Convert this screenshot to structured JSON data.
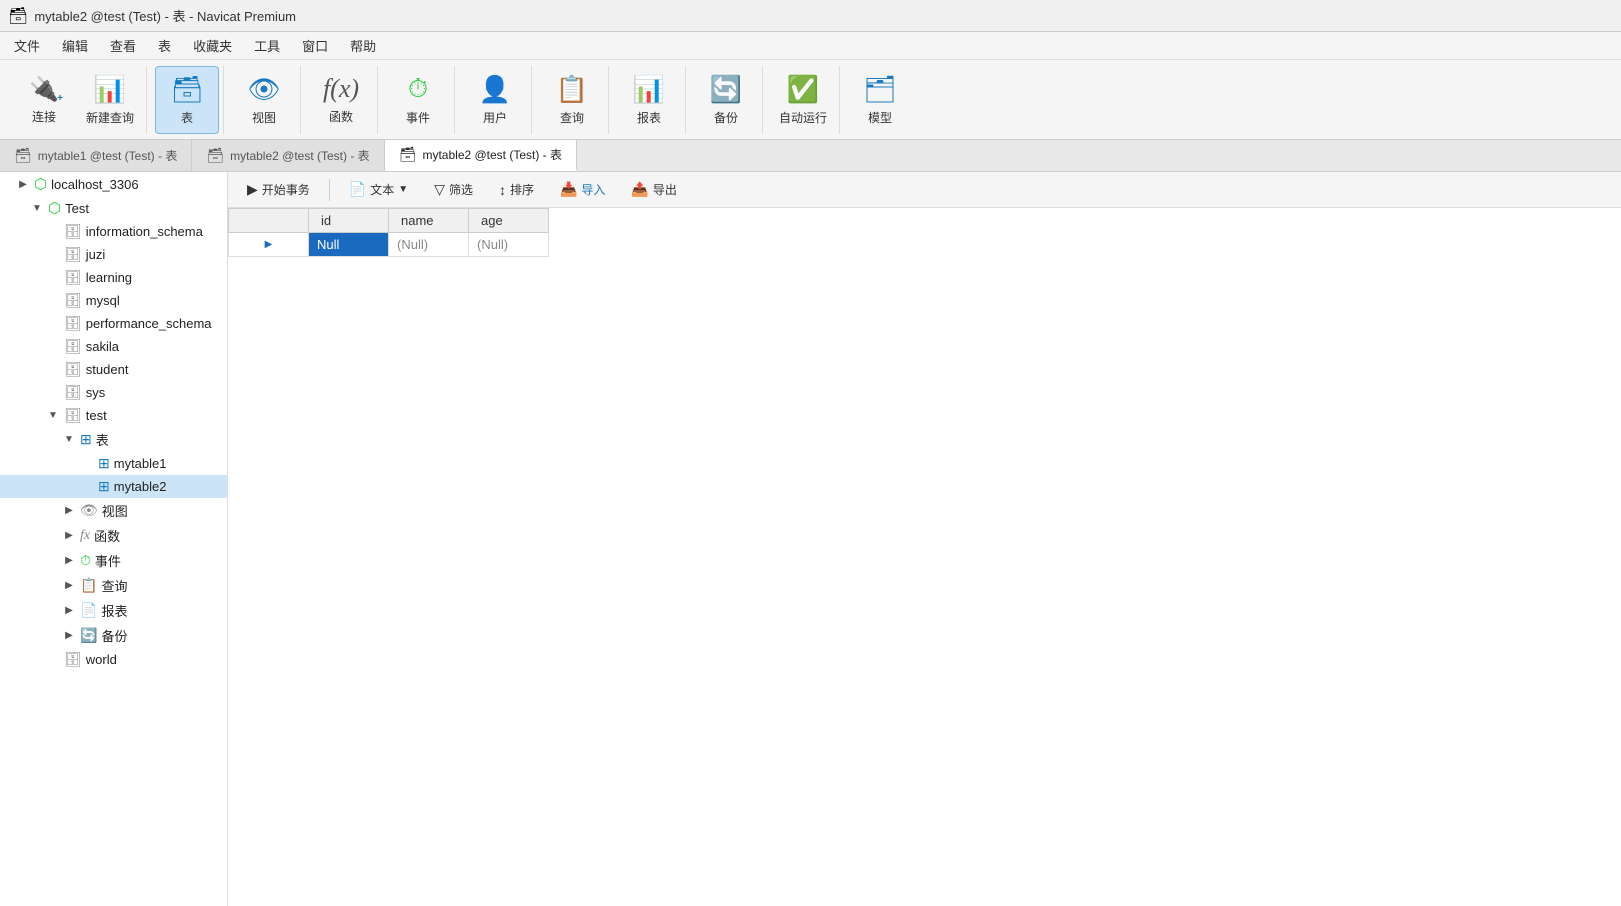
{
  "window": {
    "title": "mytable2 @test (Test) - 表 - Navicat Premium"
  },
  "menu": {
    "items": [
      "文件",
      "编辑",
      "查看",
      "表",
      "收藏夹",
      "工具",
      "窗口",
      "帮助"
    ]
  },
  "toolbar": {
    "groups": [
      {
        "buttons": [
          {
            "id": "connect",
            "label": "连接",
            "icon": "🔌"
          },
          {
            "id": "new-query",
            "label": "新建查询",
            "icon": "📊"
          }
        ]
      },
      {
        "buttons": [
          {
            "id": "table",
            "label": "表",
            "icon": "🗃",
            "active": true
          }
        ]
      },
      {
        "buttons": [
          {
            "id": "view",
            "label": "视图",
            "icon": "👁"
          }
        ]
      },
      {
        "buttons": [
          {
            "id": "function",
            "label": "函数",
            "icon": "𝑓"
          }
        ]
      },
      {
        "buttons": [
          {
            "id": "event",
            "label": "事件",
            "icon": "⏰"
          }
        ]
      },
      {
        "buttons": [
          {
            "id": "user",
            "label": "用户",
            "icon": "👤"
          }
        ]
      },
      {
        "buttons": [
          {
            "id": "query",
            "label": "查询",
            "icon": "📋"
          }
        ]
      },
      {
        "buttons": [
          {
            "id": "report",
            "label": "报表",
            "icon": "📊"
          }
        ]
      },
      {
        "buttons": [
          {
            "id": "backup",
            "label": "备份",
            "icon": "💾"
          }
        ]
      },
      {
        "buttons": [
          {
            "id": "autorun",
            "label": "自动运行",
            "icon": "⚙"
          }
        ]
      },
      {
        "buttons": [
          {
            "id": "model",
            "label": "模型",
            "icon": "🗂"
          }
        ]
      }
    ]
  },
  "tabs": [
    {
      "id": "tab1",
      "label": "mytable1 @test (Test) - 表",
      "active": false
    },
    {
      "id": "tab2",
      "label": "mytable2 @test (Test) - 表",
      "active": false
    },
    {
      "id": "tab3",
      "label": "mytable2 @test (Test) - 表",
      "active": true
    }
  ],
  "sidebar": {
    "items": [
      {
        "id": "localhost",
        "label": "localhost_3306",
        "level": 0,
        "expanded": true,
        "type": "connection",
        "arrow": "▶"
      },
      {
        "id": "test-db",
        "label": "Test",
        "level": 1,
        "expanded": true,
        "type": "folder",
        "arrow": "▼"
      },
      {
        "id": "information_schema",
        "label": "information_schema",
        "level": 2,
        "type": "database",
        "arrow": ""
      },
      {
        "id": "juzi",
        "label": "juzi",
        "level": 2,
        "type": "database",
        "arrow": ""
      },
      {
        "id": "learning",
        "label": "learning",
        "level": 2,
        "type": "database",
        "arrow": ""
      },
      {
        "id": "mysql",
        "label": "mysql",
        "level": 2,
        "type": "database",
        "arrow": ""
      },
      {
        "id": "performance_schema",
        "label": "performance_schema",
        "level": 2,
        "type": "database",
        "arrow": ""
      },
      {
        "id": "sakila",
        "label": "sakila",
        "level": 2,
        "type": "database",
        "arrow": ""
      },
      {
        "id": "student",
        "label": "student",
        "level": 2,
        "type": "database",
        "arrow": ""
      },
      {
        "id": "sys",
        "label": "sys",
        "level": 2,
        "type": "database",
        "arrow": ""
      },
      {
        "id": "test",
        "label": "test",
        "level": 2,
        "type": "database",
        "arrow": "▼",
        "expanded": true
      },
      {
        "id": "tables-group",
        "label": "表",
        "level": 3,
        "type": "group",
        "arrow": "▼",
        "expanded": true
      },
      {
        "id": "mytable1",
        "label": "mytable1",
        "level": 4,
        "type": "table",
        "arrow": ""
      },
      {
        "id": "mytable2",
        "label": "mytable2",
        "level": 4,
        "type": "table",
        "arrow": "",
        "selected": true
      },
      {
        "id": "views-group",
        "label": "视图",
        "level": 3,
        "type": "group",
        "arrow": "▶"
      },
      {
        "id": "functions-group",
        "label": "函数",
        "level": 3,
        "type": "group",
        "arrow": "▶"
      },
      {
        "id": "events-group",
        "label": "事件",
        "level": 3,
        "type": "group",
        "arrow": "▶"
      },
      {
        "id": "queries-group",
        "label": "查询",
        "level": 3,
        "type": "group",
        "arrow": "▶"
      },
      {
        "id": "reports-group",
        "label": "报表",
        "level": 3,
        "type": "group",
        "arrow": "▶"
      },
      {
        "id": "backup-group",
        "label": "备份",
        "level": 3,
        "type": "group",
        "arrow": "▶"
      },
      {
        "id": "world",
        "label": "world",
        "level": 2,
        "type": "database",
        "arrow": ""
      }
    ]
  },
  "sub_toolbar": {
    "buttons": [
      {
        "id": "begin-transaction",
        "label": "开始事务",
        "icon": "▶"
      },
      {
        "id": "text",
        "label": "文本",
        "icon": "📄",
        "has_dropdown": true
      },
      {
        "id": "filter",
        "label": "筛选",
        "icon": "🔽"
      },
      {
        "id": "sort",
        "label": "排序",
        "icon": "↕"
      },
      {
        "id": "import",
        "label": "导入",
        "icon": "📥"
      },
      {
        "id": "export",
        "label": "导出",
        "icon": "📤"
      }
    ]
  },
  "table": {
    "columns": [
      "id",
      "name",
      "age"
    ],
    "rows": [
      {
        "arrow": "▶",
        "id": "Null",
        "name": "(Null)",
        "age": "(Null)",
        "selected": true
      }
    ]
  },
  "colors": {
    "active_tab_bg": "#ffffff",
    "toolbar_active": "#cce4f7",
    "selected_cell": "#1a6bc0",
    "selected_row_bg": "#cce4f7"
  }
}
